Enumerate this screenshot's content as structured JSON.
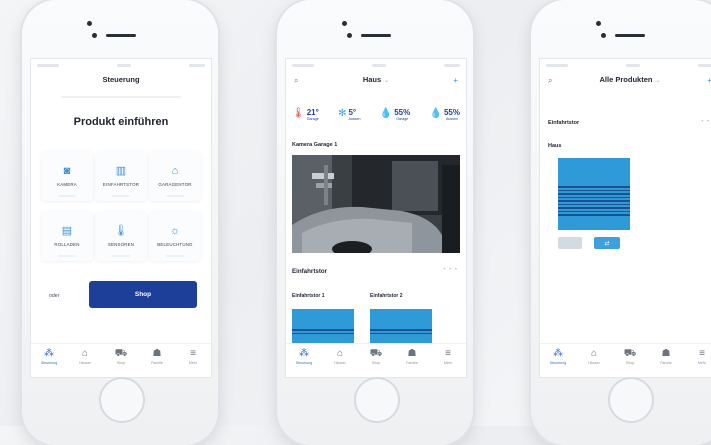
{
  "phones": [
    {
      "title": "Steuerung",
      "heading": "Produkt einführen",
      "grid": [
        {
          "icon": "camera-icon",
          "glyph": "◙",
          "label": "KAMERA"
        },
        {
          "icon": "gate-icon",
          "glyph": "▥",
          "label": "EINFAHRTSTOR"
        },
        {
          "icon": "garage-icon",
          "glyph": "⌂",
          "label": "GARAGENTOR"
        },
        {
          "icon": "shutter-icon",
          "glyph": "▤",
          "label": "ROLLADEN"
        },
        {
          "icon": "thermometer-icon",
          "glyph": "🌡",
          "label": "SENSOREN"
        },
        {
          "icon": "light-icon",
          "glyph": "☼",
          "label": "BELEUCHTUNG"
        }
      ],
      "or_label": "oder",
      "shop_label": "Shop"
    },
    {
      "title": "Haus",
      "stats": [
        {
          "icon": "thermometer-icon",
          "value": "21°",
          "label": "Garage"
        },
        {
          "icon": "snow-icon",
          "value": "5°",
          "label": "Aussen"
        },
        {
          "icon": "humidity-icon",
          "value": "55%",
          "label": "Garage"
        },
        {
          "icon": "humidity-icon",
          "value": "55%",
          "label": "Aussen"
        }
      ],
      "camera_title": "Kamera Garage 1",
      "section_title": "Einfahrtstor",
      "more": "• • •",
      "doors": [
        "Einfahrtstor 1",
        "Einfahrtstor 2"
      ]
    },
    {
      "title": "Alle Produkten",
      "section_title": "Einfahrtstor",
      "more": "• • •",
      "group_title": "Haus"
    }
  ],
  "tabs": [
    {
      "icon": "controls-icon",
      "glyph": "⁂",
      "label": "Steuerung"
    },
    {
      "icon": "house-icon",
      "glyph": "⌂",
      "label": "Häuser"
    },
    {
      "icon": "cart-icon",
      "glyph": "⛟",
      "label": "Shop"
    },
    {
      "icon": "family-icon",
      "glyph": "☗",
      "label": "Familie"
    },
    {
      "icon": "menu-icon",
      "glyph": "≡",
      "label": "Mehr"
    }
  ],
  "colors": {
    "accent": "#3e8fd6",
    "brand": "#1d3f9a",
    "door": "#2f9ad8"
  }
}
